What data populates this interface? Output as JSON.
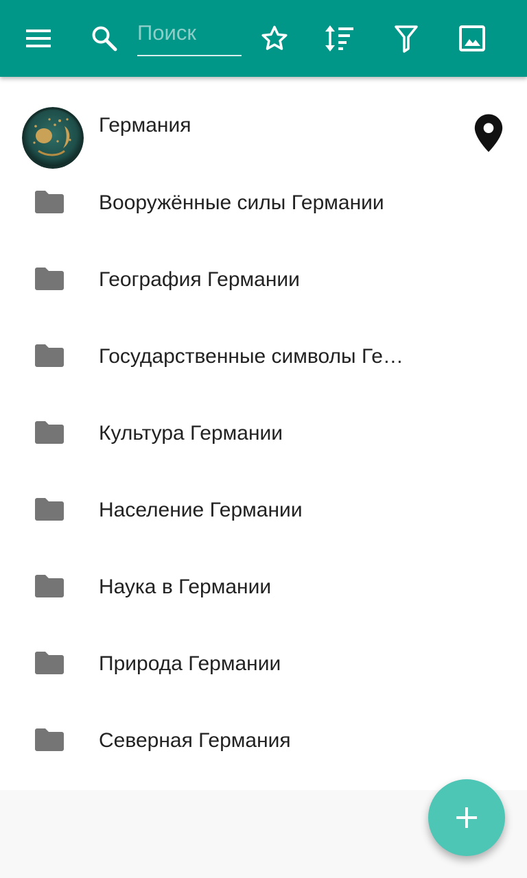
{
  "toolbar": {
    "search_placeholder": "Поиск",
    "search_value": "",
    "icons": [
      "menu-icon",
      "search-icon",
      "star-icon",
      "sort-icon",
      "filter-icon",
      "image-icon"
    ],
    "background_color": "#009688"
  },
  "header_item": {
    "label": "Германия",
    "has_location": true
  },
  "categories": [
    {
      "label": "Вооружённые силы Германии"
    },
    {
      "label": "География Германии"
    },
    {
      "label": "Государственные символы Ге…"
    },
    {
      "label": "Культура Германии"
    },
    {
      "label": "Население Германии"
    },
    {
      "label": "Наука в Германии"
    },
    {
      "label": "Природа Германии"
    },
    {
      "label": "Северная Германия"
    }
  ],
  "fab": {
    "icon": "plus-icon",
    "color": "#4dc6b6"
  }
}
